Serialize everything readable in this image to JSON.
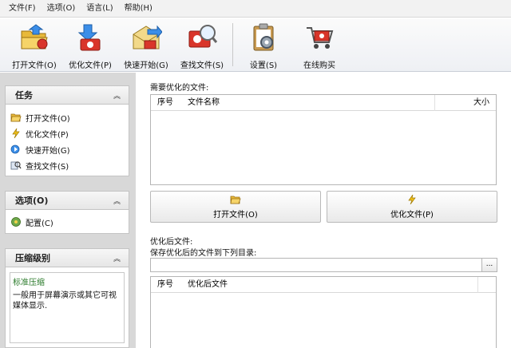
{
  "menu": {
    "items": [
      "文件(F)",
      "选项(O)",
      "语言(L)",
      "帮助(H)"
    ]
  },
  "toolbar": {
    "buttons": [
      {
        "label": "打开文件(O)",
        "icon": "open-file-icon"
      },
      {
        "label": "优化文件(P)",
        "icon": "optimize-file-icon"
      },
      {
        "label": "快速开始(G)",
        "icon": "quick-start-icon"
      },
      {
        "label": "查找文件(S)",
        "icon": "find-file-icon"
      },
      {
        "label": "设置(S)",
        "icon": "settings-icon"
      },
      {
        "label": "在线购买",
        "icon": "buy-online-icon"
      }
    ]
  },
  "sidebar": {
    "tasks": {
      "title": "任务",
      "items": [
        {
          "label": "打开文件(O)",
          "icon": "folder-icon"
        },
        {
          "label": "优化文件(P)",
          "icon": "lightning-icon"
        },
        {
          "label": "快速开始(G)",
          "icon": "quick-start-icon"
        },
        {
          "label": "查找文件(S)",
          "icon": "find-icon"
        }
      ]
    },
    "options": {
      "title": "选项(O)",
      "items": [
        {
          "label": "配置(C)",
          "icon": "config-icon"
        }
      ]
    },
    "compression": {
      "title": "压缩级别",
      "level": "标准压缩",
      "description": "一般用于屏幕演示或其它可视媒体显示."
    }
  },
  "main": {
    "files_label": "需要优化的文件:",
    "files_table": {
      "col_no": "序号",
      "col_name": "文件名称",
      "col_size": "大小"
    },
    "open_button": "打开文件(O)",
    "optimize_button": "优化文件(P)",
    "output_label": "优化后文件:",
    "save_label": "保存优化后的文件到下列目录:",
    "browse_label": "...",
    "output_table": {
      "col_no": "序号",
      "col_name": "优化后文件"
    }
  },
  "colors": {
    "accent": "#2a7a2a",
    "sidebar_bg": "#d8d8d8"
  }
}
